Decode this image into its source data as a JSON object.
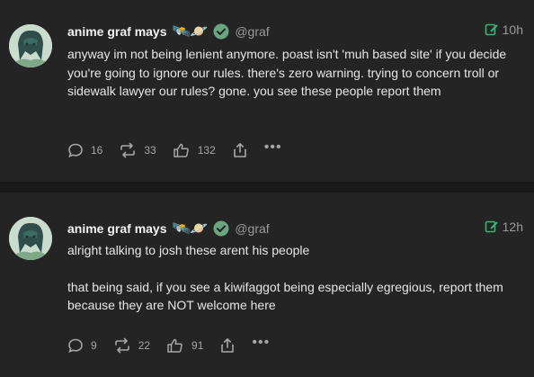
{
  "posts": [
    {
      "author_name": "anime graf mays",
      "emojis": "🛰️🪐",
      "handle": "@graf",
      "timestamp": "10h",
      "paragraphs": [
        "anyway im not being lenient anymore. poast isn't 'muh based site' if you decide you're going to ignore our rules. there's zero warning. trying to concern troll or sidewalk lawyer our rules? gone. you see these people report them"
      ],
      "replies": "16",
      "reposts": "33",
      "likes": "132"
    },
    {
      "author_name": "anime graf mays",
      "emojis": "🛰️🪐",
      "handle": "@graf",
      "timestamp": "12h",
      "paragraphs": [
        "alright talking to josh these arent his people",
        "that being said, if you see a kiwifaggot being especially egregious, report them because they are NOT welcome here"
      ],
      "replies": "9",
      "reposts": "22",
      "likes": "91"
    }
  ],
  "colors": {
    "background": "#1a1a1a",
    "card": "#242424",
    "verified": "#6aa57f",
    "edited_icon": "#3fb07a",
    "muted": "#9a9a9a"
  },
  "icons": [
    "avatar",
    "verified-icon",
    "edited-icon",
    "reply-icon",
    "repost-icon",
    "like-icon",
    "share-icon",
    "more-icon"
  ]
}
